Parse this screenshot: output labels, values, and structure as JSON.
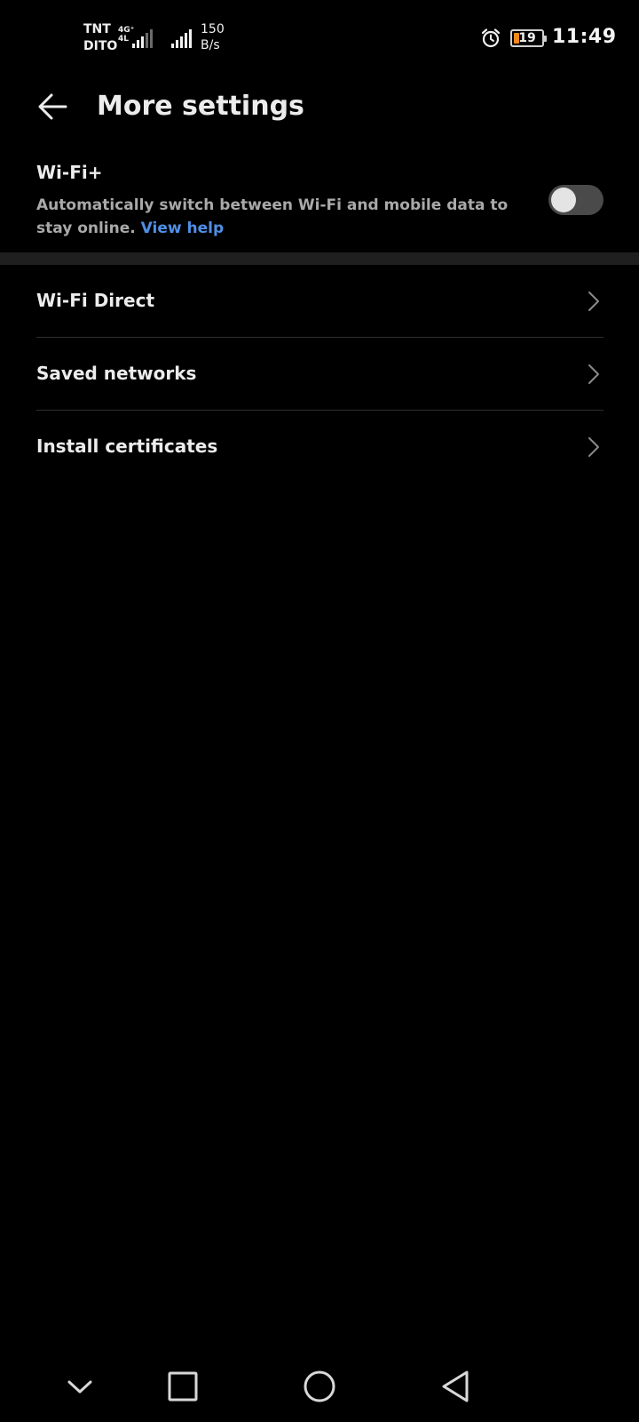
{
  "status_bar": {
    "carrier_1": "TNT",
    "carrier_2": "DITO",
    "network_type_top": "4G⁺",
    "network_type_bottom": "4L",
    "speed_value": "150",
    "speed_unit": "B/s",
    "battery_level": "19",
    "battery_fraction": 0.19,
    "time": "11:49",
    "icons": [
      "signal-icon",
      "signal-icon",
      "alarm-icon",
      "battery-icon"
    ]
  },
  "header": {
    "title": "More settings",
    "back_icon": "arrow-left-icon"
  },
  "wifi_plus": {
    "title": "Wi-Fi+",
    "description": "Automatically switch between Wi-Fi and mobile data to stay online.",
    "help_link": "View help",
    "enabled": false
  },
  "menu": {
    "items": [
      {
        "label": "Wi-Fi Direct"
      },
      {
        "label": "Saved networks"
      },
      {
        "label": "Install certificates"
      }
    ]
  },
  "nav_bar": {
    "icons": [
      "chevron-down-icon",
      "square-icon",
      "circle-icon",
      "triangle-back-icon"
    ]
  },
  "colors": {
    "background": "#000000",
    "text_primary": "#ececec",
    "text_secondary": "#a9a9a9",
    "link": "#4f8fe6",
    "battery_accent": "#f08a1c",
    "section_separator": "#1f1f1f"
  }
}
